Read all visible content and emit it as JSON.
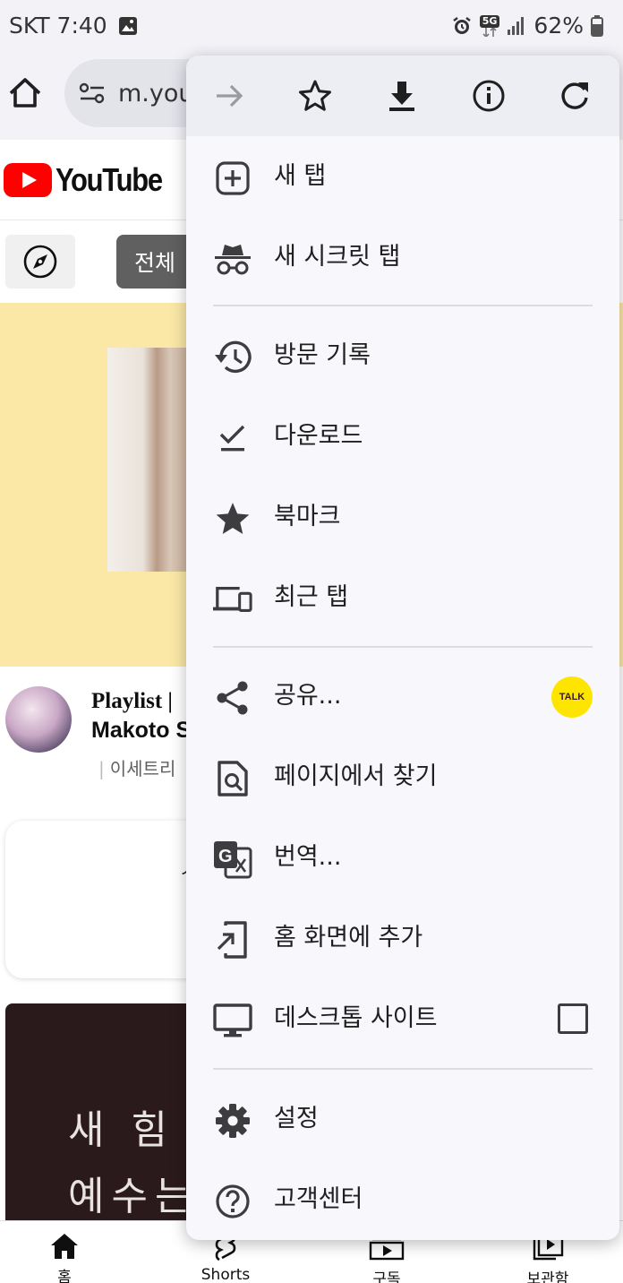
{
  "status_bar": {
    "carrier_time": "SKT 7:40",
    "network": "5G",
    "battery": "62%"
  },
  "browser": {
    "url_partial": "m.you"
  },
  "page": {
    "logo_text": "YouTube",
    "chip_all": "전체",
    "video_title_line1": "Playlist |",
    "video_title_line2": "Makoto S",
    "video_channel": "이세트리",
    "card_text": "ㅅ",
    "poster_line1": "새 힘",
    "poster_line2": "예수는",
    "nav": {
      "home": "홈",
      "shorts": "Shorts",
      "subscriptions": "구독",
      "library": "보관함"
    }
  },
  "menu": {
    "toolbar": {
      "forward_icon": "arrow-forward-icon",
      "bookmark_icon": "star-outline-icon",
      "download_icon": "download-icon",
      "info_icon": "info-icon",
      "refresh_icon": "refresh-icon"
    },
    "items": {
      "new_tab": "새 탭",
      "incognito": "새 시크릿 탭",
      "history": "방문 기록",
      "downloads": "다운로드",
      "bookmarks": "북마크",
      "recent_tabs": "최근 탭",
      "share": "공유...",
      "find_in_page": "페이지에서 찾기",
      "translate": "번역...",
      "add_to_home": "홈 화면에 추가",
      "desktop_site": "데스크톱 사이트",
      "settings": "설정",
      "help": "고객센터"
    },
    "share_app_badge": "TALK",
    "desktop_site_checked": false
  },
  "colors": {
    "youtube_red": "#ff0000",
    "kakao_yellow": "#fee500",
    "menu_bg": "#f7f7fc"
  }
}
